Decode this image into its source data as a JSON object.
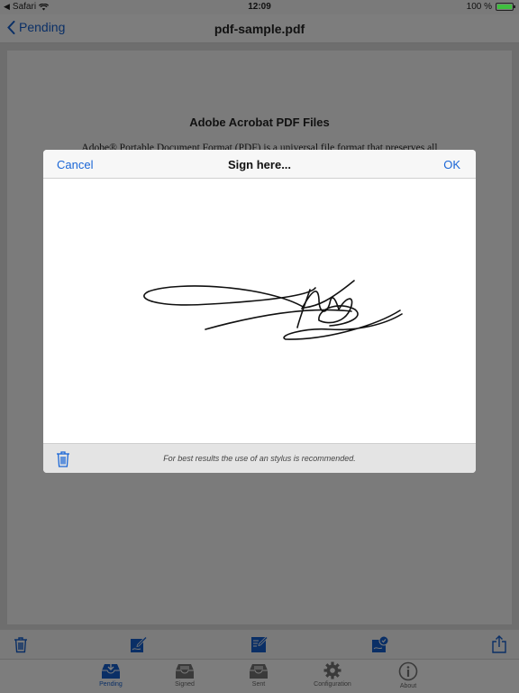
{
  "status_bar": {
    "carrier": "Safari",
    "time": "12:09",
    "battery": "100 %"
  },
  "nav": {
    "back_label": "Pending",
    "title": "pdf-sample.pdf"
  },
  "document": {
    "heading": "Adobe Acrobat PDF Files",
    "line": "Adobe® Portable Document Format (PDF) is a universal file format that preserves all"
  },
  "dialog": {
    "cancel_label": "Cancel",
    "title": "Sign here...",
    "ok_label": "OK",
    "hint": "For best results the use of an stylus is recommended."
  },
  "tabs": [
    {
      "label": "Pending",
      "active": true
    },
    {
      "label": "Signed"
    },
    {
      "label": "Sent"
    },
    {
      "label": "Configuration"
    },
    {
      "label": "About"
    }
  ],
  "colors": {
    "accent": "#1a66d6",
    "dark_accent": "#0a2f66"
  }
}
